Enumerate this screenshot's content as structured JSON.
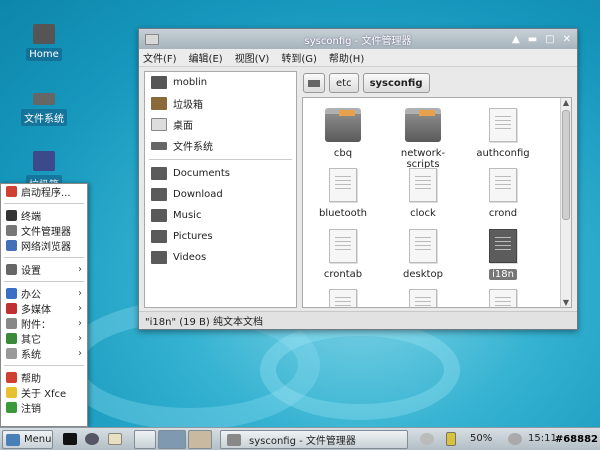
{
  "desktop": {
    "icons": [
      {
        "label": "Home"
      },
      {
        "label": "文件系统"
      },
      {
        "label": "垃圾箱"
      }
    ]
  },
  "window": {
    "title": "sysconfig - 文件管理器",
    "controls": [
      "▲",
      "▬",
      "□",
      "✕"
    ],
    "menu": [
      "文件(F)",
      "编辑(E)",
      "视图(V)",
      "转到(G)",
      "帮助(H)"
    ],
    "sidebar": {
      "places": [
        "moblin",
        "垃圾箱",
        "桌面",
        "文件系统"
      ],
      "bookmarks": [
        "Documents",
        "Download",
        "Music",
        "Pictures",
        "Videos"
      ]
    },
    "path": [
      "etc",
      "sysconfig"
    ],
    "files": [
      {
        "name": "cbq",
        "type": "folder"
      },
      {
        "name": "network-scripts",
        "type": "folder"
      },
      {
        "name": "authconfig",
        "type": "doc"
      },
      {
        "name": "bluetooth",
        "type": "doc"
      },
      {
        "name": "clock",
        "type": "doc"
      },
      {
        "name": "crond",
        "type": "doc"
      },
      {
        "name": "crontab",
        "type": "doc"
      },
      {
        "name": "desktop",
        "type": "doc"
      },
      {
        "name": "i18n",
        "type": "doc",
        "selected": true
      }
    ],
    "status": "\"i18n\" (19 B) 纯文本文档"
  },
  "start_menu": {
    "items": [
      {
        "label": "启动程序...",
        "arrow": false,
        "color": "#d04030"
      },
      {
        "sep": true
      },
      {
        "label": "终端",
        "arrow": false,
        "color": "#333"
      },
      {
        "label": "文件管理器",
        "arrow": false,
        "color": "#777"
      },
      {
        "label": "网络浏览器",
        "arrow": false,
        "color": "#4470b8"
      },
      {
        "sep": true
      },
      {
        "label": "设置",
        "arrow": true,
        "color": "#666"
      },
      {
        "sep": true
      },
      {
        "label": "办公",
        "arrow": true,
        "color": "#3a6fc4"
      },
      {
        "label": "多媒体",
        "arrow": true,
        "color": "#c03030"
      },
      {
        "label": "附件：",
        "arrow": true,
        "color": "#888"
      },
      {
        "label": "其它",
        "arrow": true,
        "color": "#3a8a3a"
      },
      {
        "label": "系统",
        "arrow": true,
        "color": "#999"
      },
      {
        "sep": true
      },
      {
        "label": "帮助",
        "arrow": false,
        "color": "#d04030"
      },
      {
        "label": "关于 Xfce",
        "arrow": false,
        "color": "#e8c030"
      },
      {
        "label": "注销",
        "arrow": false,
        "color": "#3a9a3a"
      }
    ]
  },
  "taskbar": {
    "menu_label": "Menu",
    "task_label": "sysconfig - 文件管理器",
    "battery": "50%",
    "clock": "15:11",
    "watermark": "#68882"
  }
}
